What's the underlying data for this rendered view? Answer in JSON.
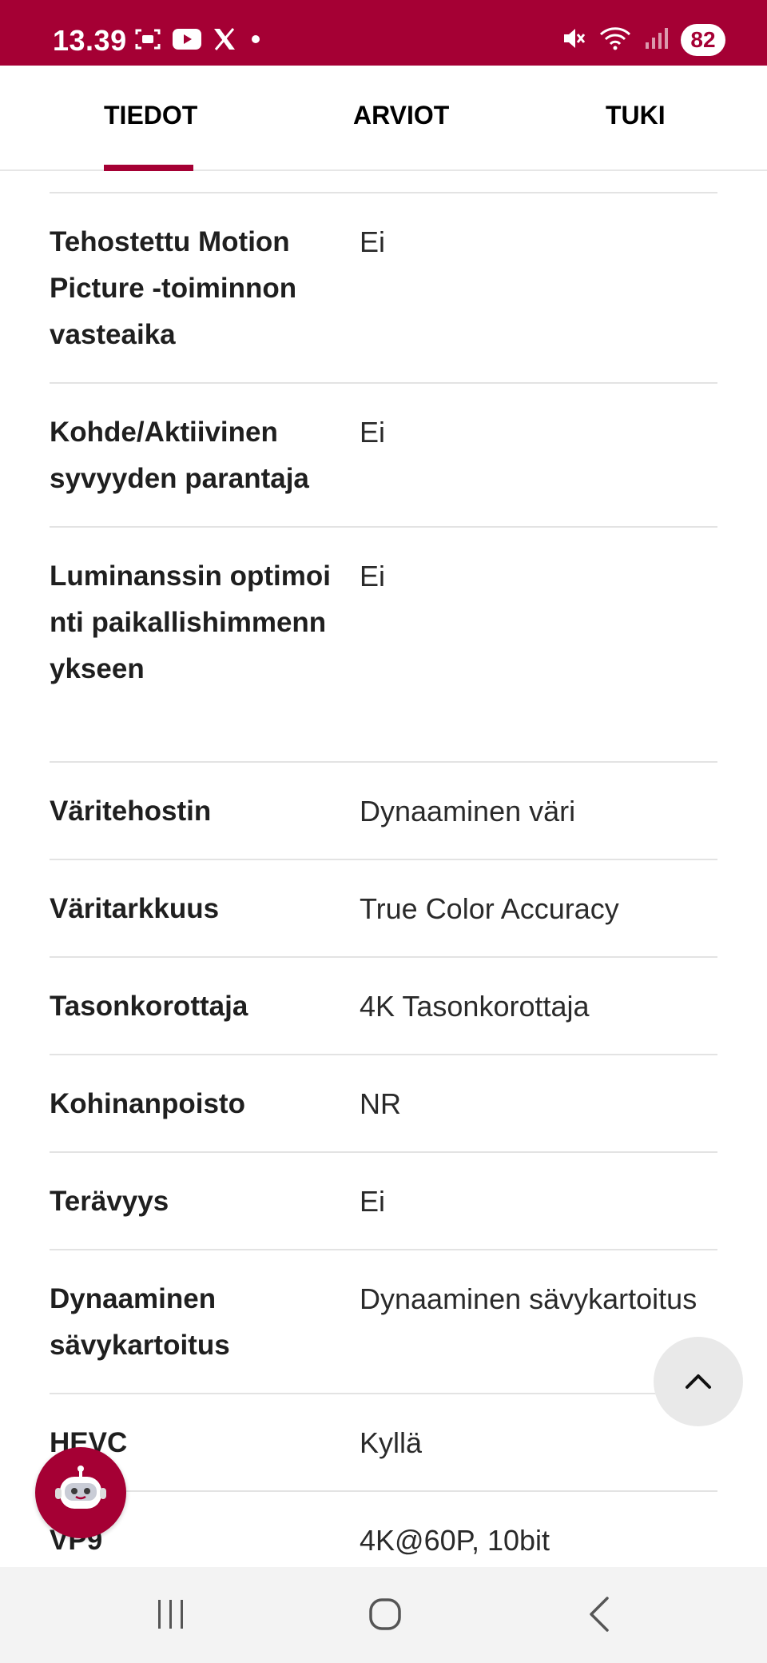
{
  "status_bar": {
    "time": "13.39",
    "battery": "82",
    "icons_left": [
      "screenshot-icon",
      "youtube-icon",
      "x-icon",
      "dot-icon"
    ],
    "icons_right": [
      "mute-icon",
      "wifi-icon",
      "signal-icon"
    ]
  },
  "tabs": [
    {
      "label": "TIEDOT",
      "active": true
    },
    {
      "label": "ARVIOT",
      "active": false
    },
    {
      "label": "TUKI",
      "active": false
    }
  ],
  "specs": [
    {
      "label": "Tehostettu Motion Picture -toiminnon vasteaika",
      "value": "Ei"
    },
    {
      "label": "Kohde/Aktiivinen syvyyden parantaja",
      "value": "Ei"
    },
    {
      "label": "Luminanssin optimointi paikallishimmennykseen",
      "value": "Ei"
    },
    {
      "label": "Väritehostin",
      "value": "Dynaaminen väri"
    },
    {
      "label": "Väritarkkuus",
      "value": "True Color Accuracy"
    },
    {
      "label": "Tasonkorottaja",
      "value": "4K Tasonkorottaja"
    },
    {
      "label": "Kohinanpoisto",
      "value": "NR"
    },
    {
      "label": "Terävyys",
      "value": "Ei"
    },
    {
      "label": "Dynaaminen sävykartoitus",
      "value": "Dynaaminen sävykartoitus"
    },
    {
      "label": "HEVC",
      "value": "Kyllä"
    },
    {
      "label": "VP9",
      "value": "4K@60P, 10bit"
    }
  ],
  "floating": {
    "scroll_top_icon": "chevron-up-icon",
    "chatbot_icon": "robot-icon"
  },
  "nav": [
    "recent-apps-icon",
    "home-icon",
    "back-icon"
  ],
  "colors": {
    "brand": "#a50034",
    "divider": "#e3e3e3",
    "nav_bg": "#f3f3f3"
  }
}
